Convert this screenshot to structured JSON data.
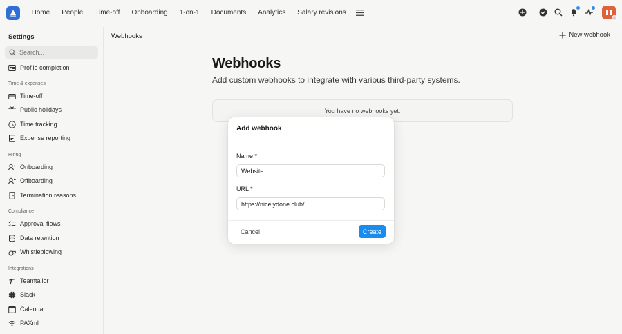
{
  "nav": {
    "items": [
      "Home",
      "People",
      "Time-off",
      "Onboarding",
      "1-on-1",
      "Documents",
      "Analytics",
      "Salary revisions"
    ],
    "menu_icon": "hamburger-icon",
    "right_icons": [
      "plus-circle-icon",
      "check-circle-icon",
      "search-icon",
      "bell-icon",
      "activity-icon"
    ]
  },
  "sidebar": {
    "title": "Settings",
    "search_placeholder": "Search...",
    "top_item": "Profile completion",
    "groups": [
      {
        "label": "Time & expenses",
        "items": [
          "Time-off",
          "Public holidays",
          "Time tracking",
          "Expense reporting"
        ]
      },
      {
        "label": "Hiring",
        "items": [
          "Onboarding",
          "Offboarding",
          "Termination reasons"
        ]
      },
      {
        "label": "Compliance",
        "items": [
          "Approval flows",
          "Data retention",
          "Whistleblowing"
        ]
      },
      {
        "label": "Integrations",
        "items": [
          "Teamtailor",
          "Slack",
          "Calendar",
          "PAXml"
        ]
      }
    ]
  },
  "main": {
    "breadcrumb": "Webhooks",
    "new_button": "New webhook",
    "title": "Webhooks",
    "subtitle": "Add custom webhooks to integrate with various third-party systems.",
    "empty_text": "You have no webhooks yet."
  },
  "modal": {
    "title": "Add webhook",
    "name_label": "Name *",
    "name_value": "Website",
    "url_label": "URL *",
    "url_value": "https://nicelydone.club/",
    "cancel": "Cancel",
    "create": "Create"
  },
  "colors": {
    "accent": "#1a8cf0",
    "logo": "#2f6fd6",
    "avatar": "#e0623a"
  }
}
